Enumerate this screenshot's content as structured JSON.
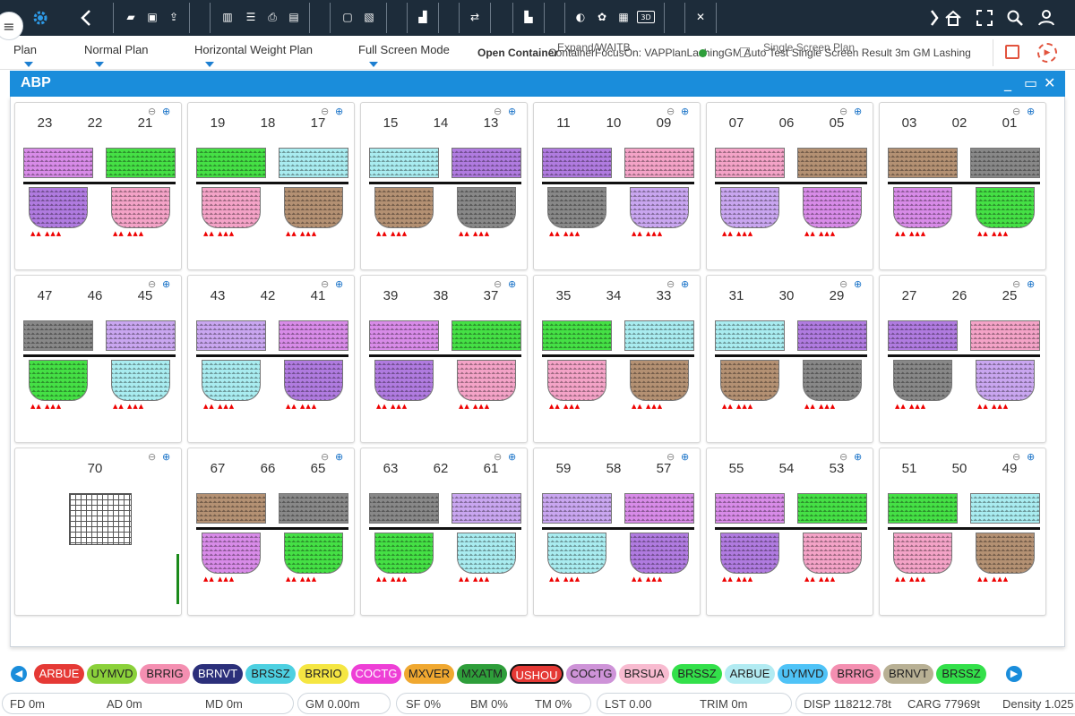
{
  "topbar": {
    "icons": [
      "gear-icon",
      "back-icon",
      "open-folder-icon",
      "save-icon",
      "export-icon",
      "layout-icon",
      "rows-icon",
      "print-icon",
      "cargo-icon",
      "image-icon",
      "chart-icon",
      "swap-icon",
      "lock-icon",
      "contrast-icon",
      "palette-icon",
      "grid-icon",
      "3d-icon",
      "close-x-icon",
      "forward-icon",
      "home-icon",
      "fullscreen-icon",
      "search-icon",
      "user-icon"
    ],
    "three_d": "3D"
  },
  "toolbar": {
    "plan": "Plan",
    "normal_plan": "Normal Plan",
    "horizontal_weight_plan": "Horizontal Weight Plan",
    "full_screen_mode": "Full Screen Mode",
    "open_container": "Open Container",
    "overlap_text": "ContainerFocusOn: VAPPlanLashingGM Auto Test Single Screen Result 3m GM Lashing",
    "extra_overlap_1": "Expand/WAITB",
    "extra_overlap_2": "Single Screen Plan"
  },
  "window": {
    "title": "ABP"
  },
  "cards": [
    {
      "nums": [
        "23",
        "22",
        "21"
      ]
    },
    {
      "nums": [
        "19",
        "18",
        "17"
      ]
    },
    {
      "nums": [
        "15",
        "14",
        "13"
      ]
    },
    {
      "nums": [
        "11",
        "10",
        "09"
      ]
    },
    {
      "nums": [
        "07",
        "06",
        "05"
      ]
    },
    {
      "nums": [
        "03",
        "02",
        "01"
      ]
    },
    {
      "nums": [
        "47",
        "46",
        "45"
      ]
    },
    {
      "nums": [
        "43",
        "42",
        "41"
      ]
    },
    {
      "nums": [
        "39",
        "38",
        "37"
      ]
    },
    {
      "nums": [
        "35",
        "34",
        "33"
      ]
    },
    {
      "nums": [
        "31",
        "30",
        "29"
      ]
    },
    {
      "nums": [
        "27",
        "26",
        "25"
      ]
    },
    {
      "nums": [
        "",
        "70",
        ""
      ]
    },
    {
      "nums": [
        "67",
        "66",
        "65"
      ]
    },
    {
      "nums": [
        "63",
        "62",
        "61"
      ]
    },
    {
      "nums": [
        "59",
        "58",
        "57"
      ]
    },
    {
      "nums": [
        "55",
        "54",
        "53"
      ]
    },
    {
      "nums": [
        "51",
        "50",
        "49"
      ]
    }
  ],
  "ports": [
    {
      "label": "ARBUE",
      "color": "#e53935",
      "text": "#fff"
    },
    {
      "label": "UYMVD",
      "color": "#8bd13a",
      "text": "#222"
    },
    {
      "label": "BRRIG",
      "color": "#f48fb1",
      "text": "#222"
    },
    {
      "label": "BRNVT",
      "color": "#2b2f7a",
      "text": "#fff"
    },
    {
      "label": "BRSSZ",
      "color": "#4dd0e1",
      "text": "#222"
    },
    {
      "label": "BRRIO",
      "color": "#f5e642",
      "text": "#222"
    },
    {
      "label": "COCTG",
      "color": "#ee3fd6",
      "text": "#fff"
    },
    {
      "label": "MXVER",
      "color": "#f0a830",
      "text": "#222"
    },
    {
      "label": "MXATM",
      "color": "#2e9e3a",
      "text": "#222"
    },
    {
      "label": "USHOU",
      "color": "#e53935",
      "text": "#fff"
    },
    {
      "label": "COCTG",
      "color": "#ce93d8",
      "text": "#222"
    },
    {
      "label": "BRSUA",
      "color": "#f8bbd0",
      "text": "#222"
    },
    {
      "label": "BRSSZ",
      "color": "#33e04a",
      "text": "#222"
    },
    {
      "label": "ARBUE",
      "color": "#b2ebf2",
      "text": "#222"
    },
    {
      "label": "UYMVD",
      "color": "#4fc3f7",
      "text": "#222"
    },
    {
      "label": "BRRIG",
      "color": "#f48fb1",
      "text": "#222"
    },
    {
      "label": "BRNVT",
      "color": "#b8b094",
      "text": "#222"
    },
    {
      "label": "BRSSZ",
      "color": "#33e04a",
      "text": "#222"
    }
  ],
  "status": {
    "fd": "FD 0m",
    "ad": "AD 0m",
    "md": "MD 0m",
    "gm": "GM 0.00m",
    "sf": "SF 0%",
    "bm": "BM 0%",
    "tm": "TM 0%",
    "lst": "LST 0.00",
    "trim": "TRIM 0m",
    "disp": "DISP 118212.78t",
    "carg": "CARG 77969t",
    "density": "Density 1.025"
  }
}
